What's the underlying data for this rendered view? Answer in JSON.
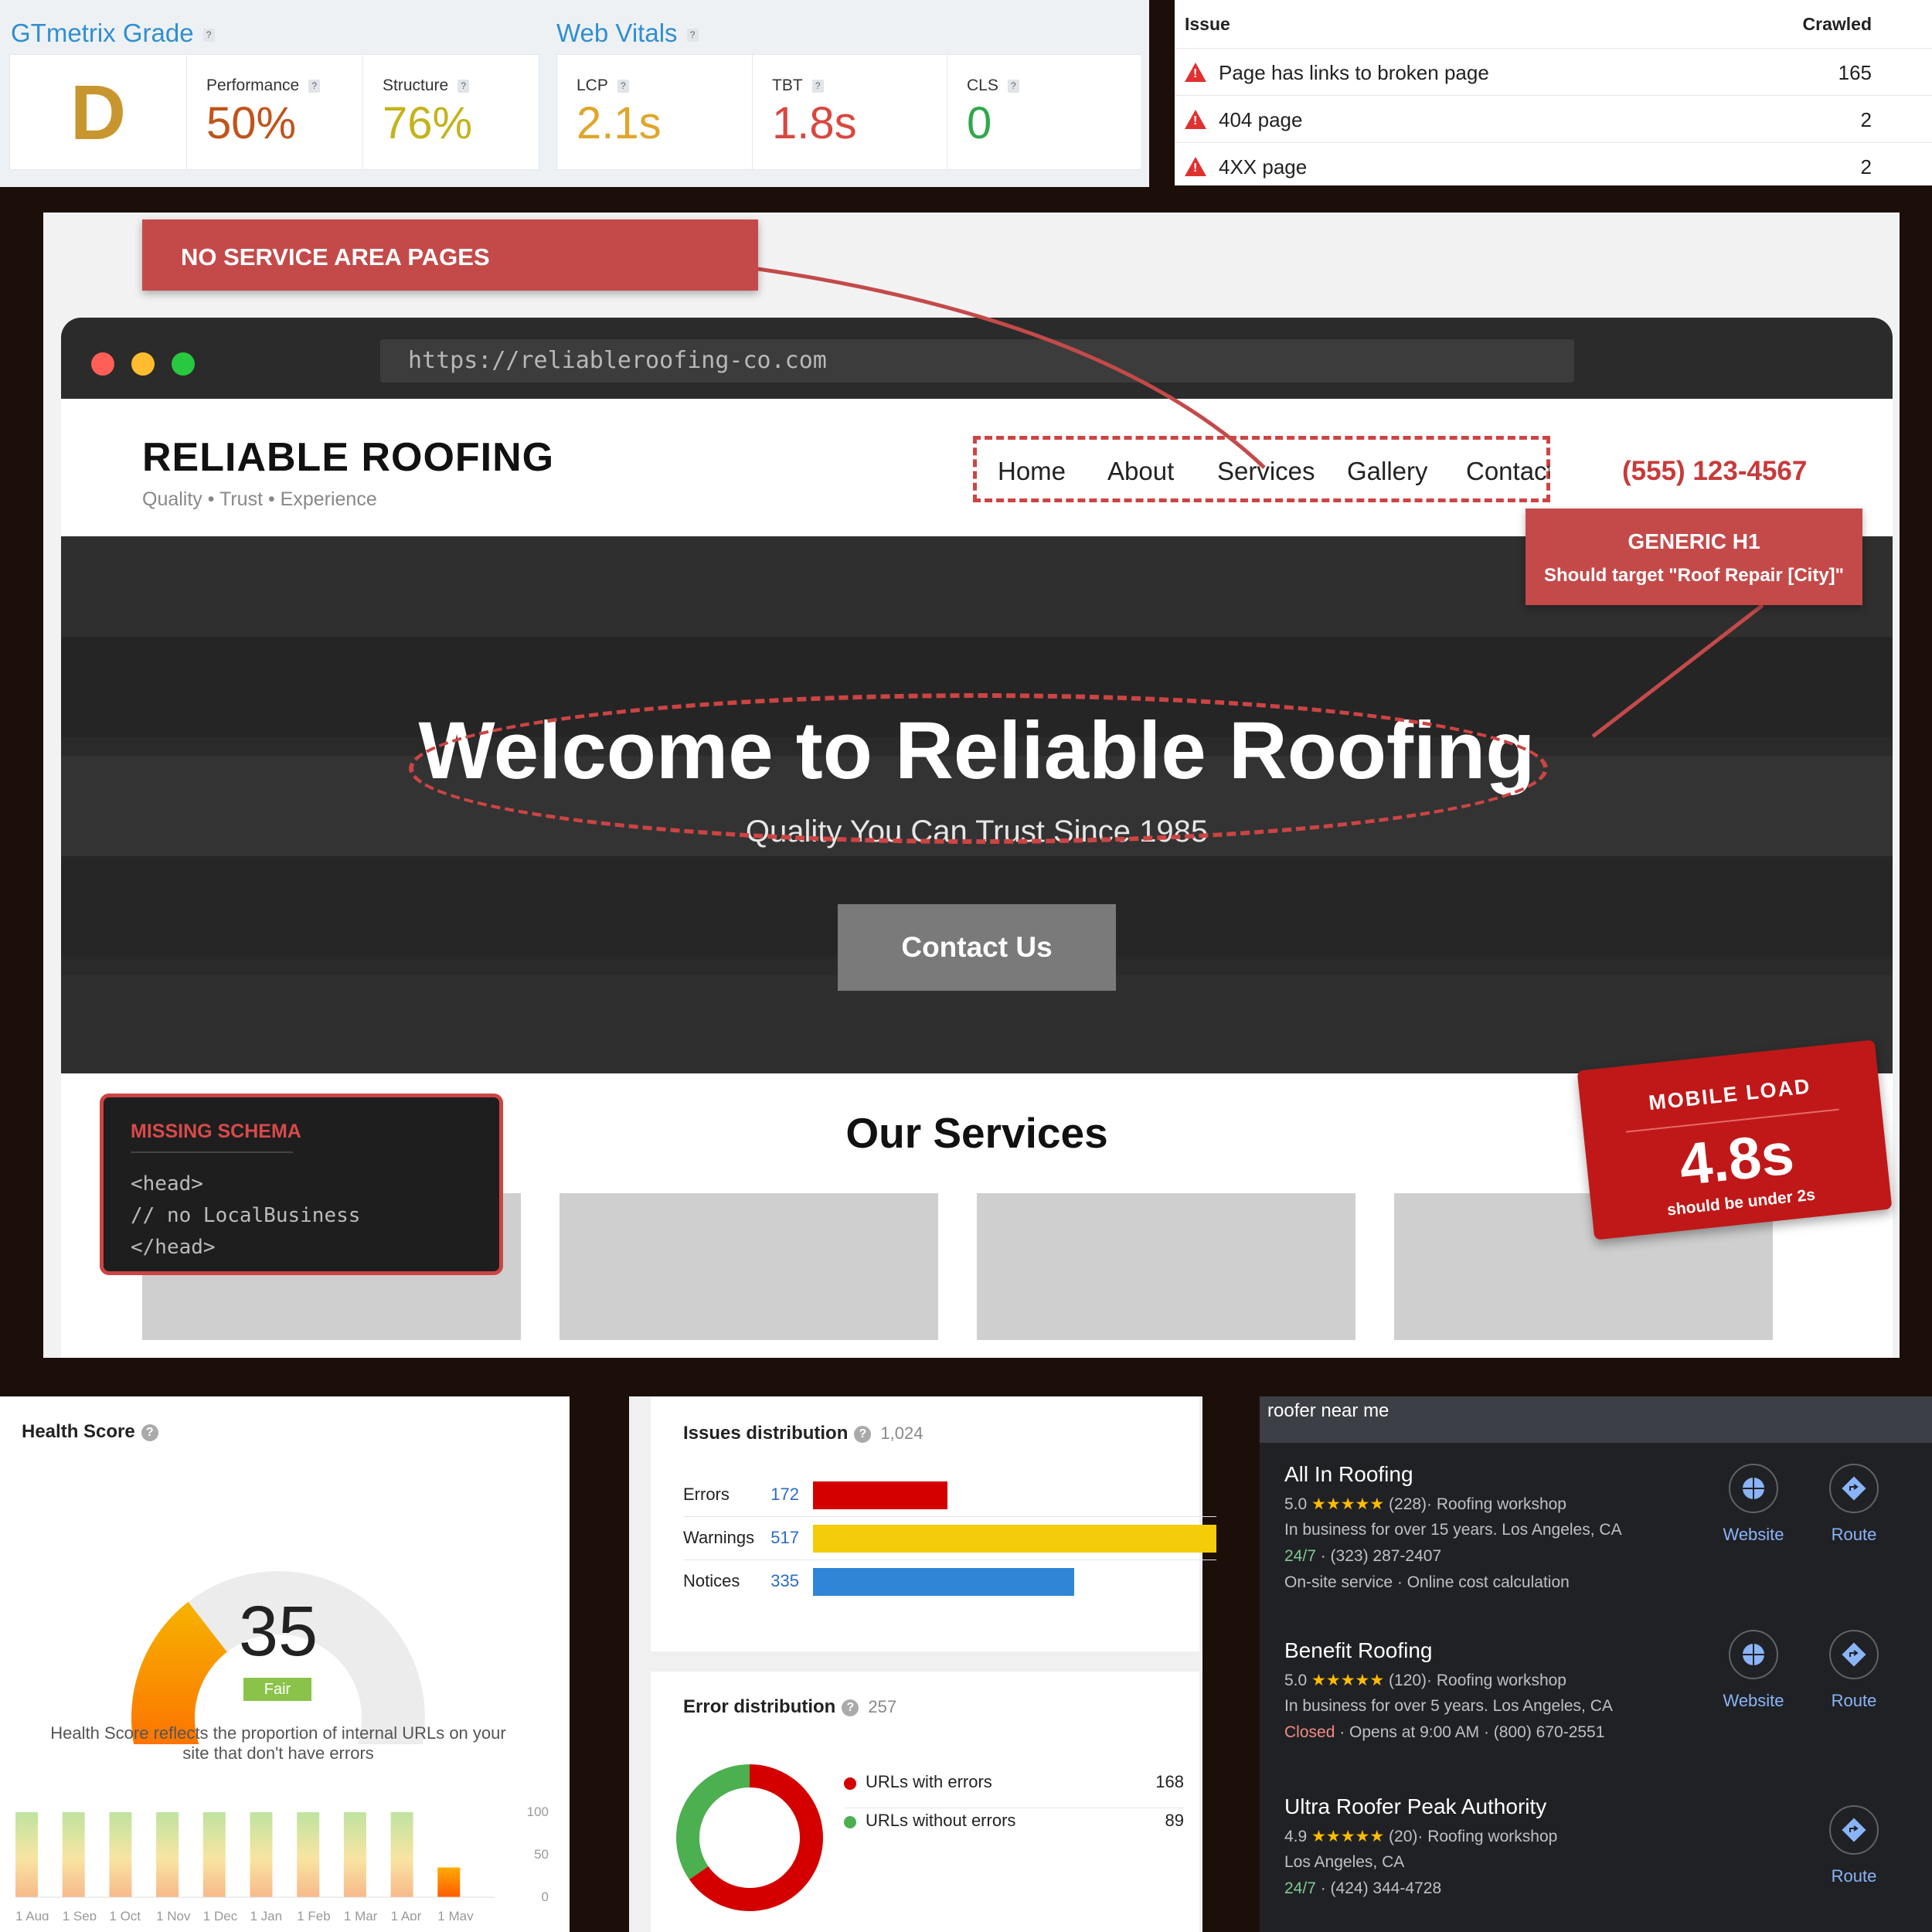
{
  "gtmetrix": {
    "grade_heading": "GTmetrix Grade",
    "vitals_heading": "Web Vitals",
    "help": "?",
    "grade": "D",
    "performance_label": "Performance",
    "performance_value": "50%",
    "structure_label": "Structure",
    "structure_value": "76%",
    "lcp_label": "LCP",
    "lcp_value": "2.1s",
    "tbt_label": "TBT",
    "tbt_value": "1.8s",
    "cls_label": "CLS",
    "cls_value": "0",
    "colors": {
      "grade": "#c8962e",
      "performance": "#c0541b",
      "structure": "#c5b31b",
      "lcp": "#e0a52b",
      "tbt": "#d9473f",
      "cls": "#2fa84a"
    }
  },
  "issues_table": {
    "col_issue": "Issue",
    "col_crawled": "Crawled",
    "rows": [
      {
        "issue": "Page has links to broken page",
        "count": "165"
      },
      {
        "issue": "404 page",
        "count": "2"
      },
      {
        "issue": "4XX page",
        "count": "2"
      }
    ]
  },
  "mockup": {
    "callout_service_areas": "NO SERVICE AREA PAGES",
    "url": "https://reliableroofing-co.com",
    "brand": "RELIABLE ROOFING",
    "tagline": "Quality • Trust • Experience",
    "nav": [
      "Home",
      "About",
      "Services",
      "Gallery",
      "Contact"
    ],
    "phone": "(555) 123-4567",
    "callout_h1_title": "GENERIC H1",
    "callout_h1_text": "Should target \"Roof Repair [City]\"",
    "hero_title": "Welcome to Reliable Roofing",
    "hero_subtitle": "Quality You Can Trust Since 1985",
    "cta": "Contact Us",
    "services_title": "Our Services",
    "schema_title": "MISSING SCHEMA",
    "schema_code": [
      "<head>",
      "// no LocalBusiness",
      "</head>"
    ],
    "mobile_title": "MOBILE LOAD",
    "mobile_value": "4.8s",
    "mobile_note": "should be under 2s"
  },
  "health": {
    "title": "Health Score",
    "score": "35",
    "score_value": 35,
    "rating": "Fair",
    "description_line1": "Health Score reflects the proportion of internal URLs on your",
    "description_line2": "site that don't have errors",
    "chart_data": {
      "type": "bar",
      "categories": [
        "1 Aug",
        "1 Sep",
        "1 Oct",
        "1 Nov",
        "1 Dec",
        "1 Jan",
        "1 Feb",
        "1 Mar",
        "1 Apr",
        "1 May"
      ],
      "values": [
        100,
        100,
        100,
        100,
        100,
        100,
        100,
        100,
        100,
        35
      ],
      "yticks": [
        "100",
        "50",
        "0"
      ],
      "ylim": [
        0,
        100
      ]
    }
  },
  "issues_distribution": {
    "title": "Issues distribution",
    "total": "1,024",
    "rows": [
      {
        "label": "Errors",
        "value": "172",
        "color": "#d40000"
      },
      {
        "label": "Warnings",
        "value": "517",
        "color": "#f5cc0a"
      },
      {
        "label": "Notices",
        "value": "335",
        "color": "#2f86d6"
      }
    ],
    "chart_data": {
      "type": "bar",
      "categories": [
        "Errors",
        "Warnings",
        "Notices"
      ],
      "values": [
        172,
        517,
        335
      ]
    }
  },
  "error_distribution": {
    "title": "Error distribution",
    "total": "257",
    "legend": [
      {
        "label": "URLs with errors",
        "value": "168",
        "color": "#d40000"
      },
      {
        "label": "URLs without errors",
        "value": "89",
        "color": "#4caf50"
      }
    ],
    "chart_data": {
      "type": "pie",
      "categories": [
        "URLs with errors",
        "URLs without errors"
      ],
      "values": [
        168,
        89
      ]
    }
  },
  "local_pack": {
    "query": "roofer near me",
    "listings": [
      {
        "name": "All In Roofing",
        "rating": "5.0",
        "stars": "★★★★★",
        "meta": "(228)· Roofing workshop",
        "about": "In business for over 15 years. Los Angeles, CA",
        "status": "24/7",
        "contact": " · (323) 287-2407",
        "extra": "On-site service · Online cost calculation",
        "website": "Website",
        "route": "Route"
      },
      {
        "name": "Benefit Roofing",
        "rating": "5.0",
        "stars": "★★★★★",
        "meta": "(120)· Roofing workshop",
        "about": "In business for over 5 years. Los Angeles, CA",
        "status": "Closed",
        "contact": " · Opens at 9:00 AM · (800) 670-2551",
        "website": "Website",
        "route": "Route"
      },
      {
        "name": "Ultra Roofer Peak Authority",
        "rating": "4.9",
        "stars": "★★★★★",
        "meta": "(20)· Roofing workshop",
        "about": "Los Angeles, CA",
        "status": "24/7",
        "contact": " · (424) 344-4728",
        "route": "Route"
      }
    ]
  }
}
